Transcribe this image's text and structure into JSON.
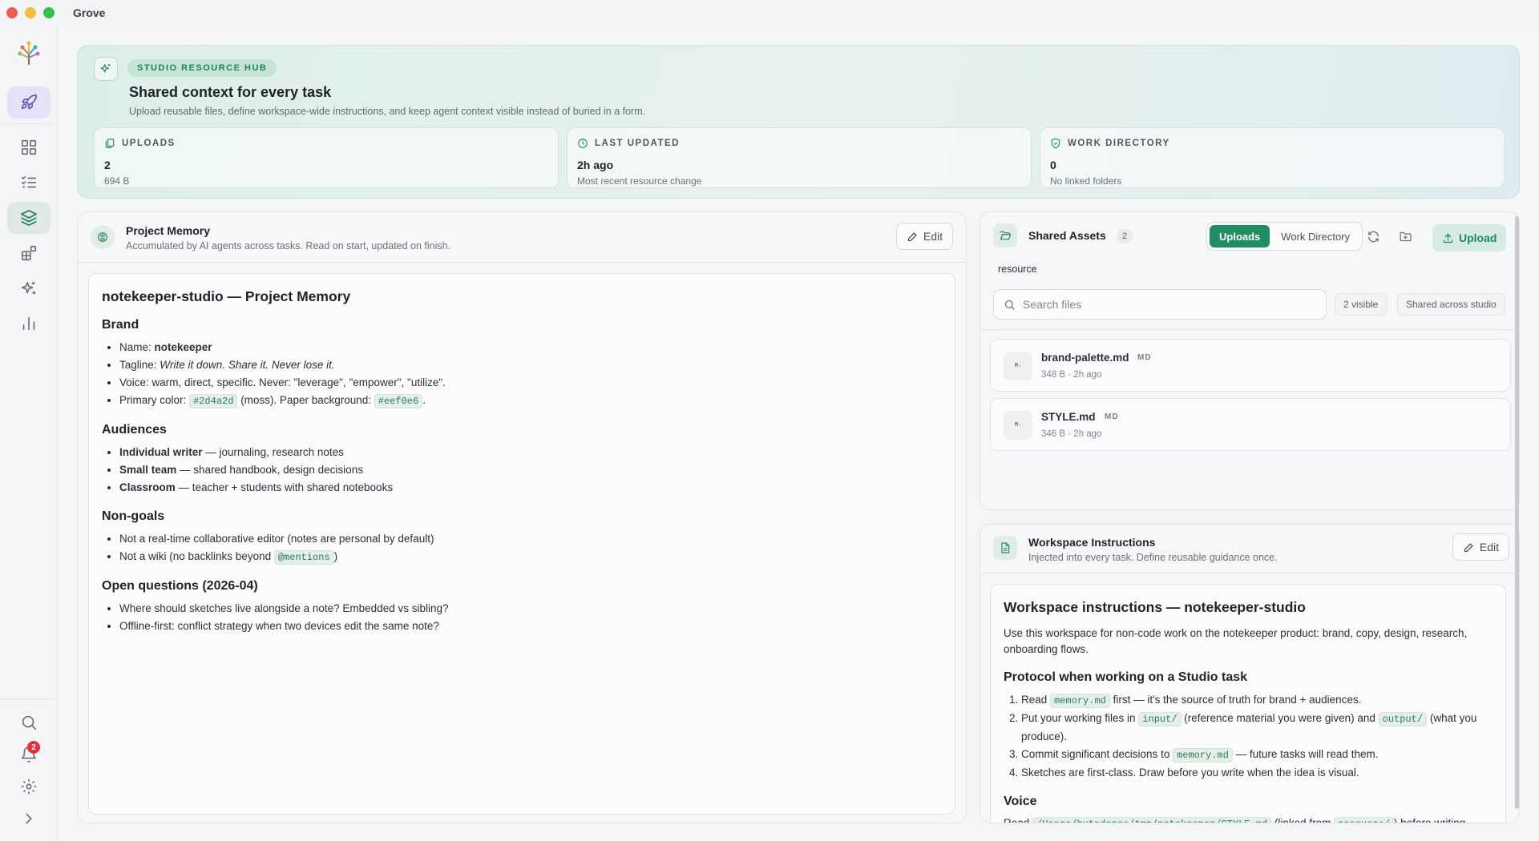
{
  "window": {
    "title": "Grove"
  },
  "sidebar": {
    "notifications_count": "2",
    "colors": {
      "active": "#1d7d5c",
      "launch": "#5c55c8"
    }
  },
  "hero": {
    "pill": "STUDIO RESOURCE HUB",
    "title": "Shared context for every task",
    "subtitle": "Upload reusable files, define workspace-wide instructions, and keep agent context visible instead of buried in a form.",
    "stats": [
      {
        "label": "UPLOADS",
        "value": "2",
        "sub": "694 B",
        "icon": "file-stack-icon"
      },
      {
        "label": "LAST UPDATED",
        "value": "2h ago",
        "sub": "Most recent resource change",
        "icon": "clock-icon"
      },
      {
        "label": "WORK DIRECTORY",
        "value": "0",
        "sub": "No linked folders",
        "icon": "shield-check-icon"
      }
    ]
  },
  "memory": {
    "title": "Project Memory",
    "subtitle": "Accumulated by AI agents across tasks. Read on start, updated on finish.",
    "edit_label": "Edit",
    "doc": {
      "heading": "notekeeper-studio — Project Memory",
      "brand_heading": "Brand",
      "brand": {
        "name_label": "Name: ",
        "name_value": "notekeeper",
        "tagline_label": "Tagline: ",
        "tagline_value": "Write it down. Share it. Never lose it.",
        "voice": "Voice: warm, direct, specific. Never: \"leverage\", \"empower\", \"utilize\".",
        "primary_label": "Primary color: ",
        "primary_code": "#2d4a2d",
        "primary_mid": " (moss). Paper background: ",
        "paper_code": "#eef0e6",
        "primary_end": "."
      },
      "audiences_heading": "Audiences",
      "audiences": [
        {
          "bold": "Individual writer",
          "rest": " — journaling, research notes"
        },
        {
          "bold": "Small team",
          "rest": " — shared handbook, design decisions"
        },
        {
          "bold": "Classroom",
          "rest": " — teacher + students with shared notebooks"
        }
      ],
      "nongoals_heading": "Non-goals",
      "nongoal_1": "Not a real-time collaborative editor (notes are personal by default)",
      "nongoal_2_pre": "Not a wiki (no backlinks beyond ",
      "nongoal_2_code": "@mentions",
      "nongoal_2_post": ")",
      "questions_heading": "Open questions (2026-04)",
      "questions": [
        "Where should sketches live alongside a note? Embedded vs sibling?",
        "Offline-first: conflict strategy when two devices edit the same note?"
      ]
    }
  },
  "assets": {
    "title": "Shared Assets",
    "count": "2",
    "tabs": [
      "Uploads",
      "Work Directory"
    ],
    "upload_label": "Upload",
    "folder_label": "resource",
    "search_placeholder": "Search files",
    "visible_chip": "2 visible",
    "scope_chip": "Shared across studio",
    "files": [
      {
        "name": "brand-palette.md",
        "tag": "MD",
        "size": "348 B",
        "time": "2h ago",
        "thumb": "M↓"
      },
      {
        "name": "STYLE.md",
        "tag": "MD",
        "size": "346 B",
        "time": "2h ago",
        "thumb": "M↓"
      }
    ],
    "accent": "#1d8f63"
  },
  "instructions": {
    "title": "Workspace Instructions",
    "subtitle": "Injected into every task. Define reusable guidance once.",
    "edit_label": "Edit",
    "doc": {
      "heading": "Workspace instructions — notekeeper-studio",
      "intro": "Use this workspace for non-code work on the notekeeper product: brand, copy, design, research, onboarding flows.",
      "protocol_heading": "Protocol when working on a Studio task",
      "step1_pre": "Read ",
      "step1_code": "memory.md",
      "step1_post": " first — it's the source of truth for brand + audiences.",
      "step2_pre": "Put your working files in ",
      "step2_code1": "input/",
      "step2_mid": " (reference material you were given) and ",
      "step2_code2": "output/",
      "step2_post": " (what you produce).",
      "step3_pre": "Commit significant decisions to ",
      "step3_code": "memory.md",
      "step3_post": " — future tasks will read them.",
      "step4": "Sketches are first-class. Draw before you write when the idea is visual.",
      "voice_heading": "Voice",
      "voice_pre": "Read ",
      "voice_code1": "/Users/hutedance/tmp/notekeeper/STYLE.md",
      "voice_mid": " (linked from ",
      "voice_code2": "resource/",
      "voice_post": ") before writing"
    }
  }
}
